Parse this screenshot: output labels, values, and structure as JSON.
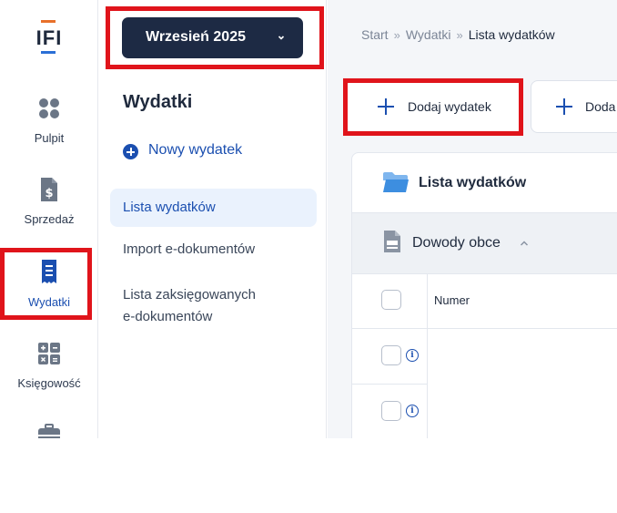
{
  "logo": {
    "text": "IFI"
  },
  "rail": {
    "items": [
      {
        "label": "Pulpit",
        "icon": "dots-grid-icon"
      },
      {
        "label": "Sprzedaż",
        "icon": "dollar-document-icon"
      },
      {
        "label": "Wydatki",
        "icon": "receipt-icon",
        "active": true
      },
      {
        "label": "Księgowość",
        "icon": "calculator-icon"
      },
      {
        "label": "",
        "icon": "briefcase-icon"
      }
    ]
  },
  "subnav": {
    "month": "Wrzesień 2025",
    "title": "Wydatki",
    "new_expense": "Nowy wydatek",
    "items": [
      {
        "label": "Lista wydatków",
        "active": true
      },
      {
        "label": "Import e-dokumentów"
      },
      {
        "label": "Lista zaksięgowanych",
        "label2": "e-dokumentów"
      }
    ]
  },
  "breadcrumb": {
    "items": [
      "Start",
      "Wydatki",
      "Lista wydatków"
    ],
    "separator": "»"
  },
  "actions": {
    "add_expense": "Dodaj wydatek",
    "add_other": "Doda"
  },
  "panel": {
    "title": "Lista wydatków",
    "section": "Dowody obce",
    "columns": [
      "Numer"
    ],
    "info_glyph": "i"
  },
  "colors": {
    "accent": "#1b4fb0",
    "dark_button": "#1d2a44",
    "highlight": "#e0141b",
    "logo_orange": "#e8702a"
  }
}
